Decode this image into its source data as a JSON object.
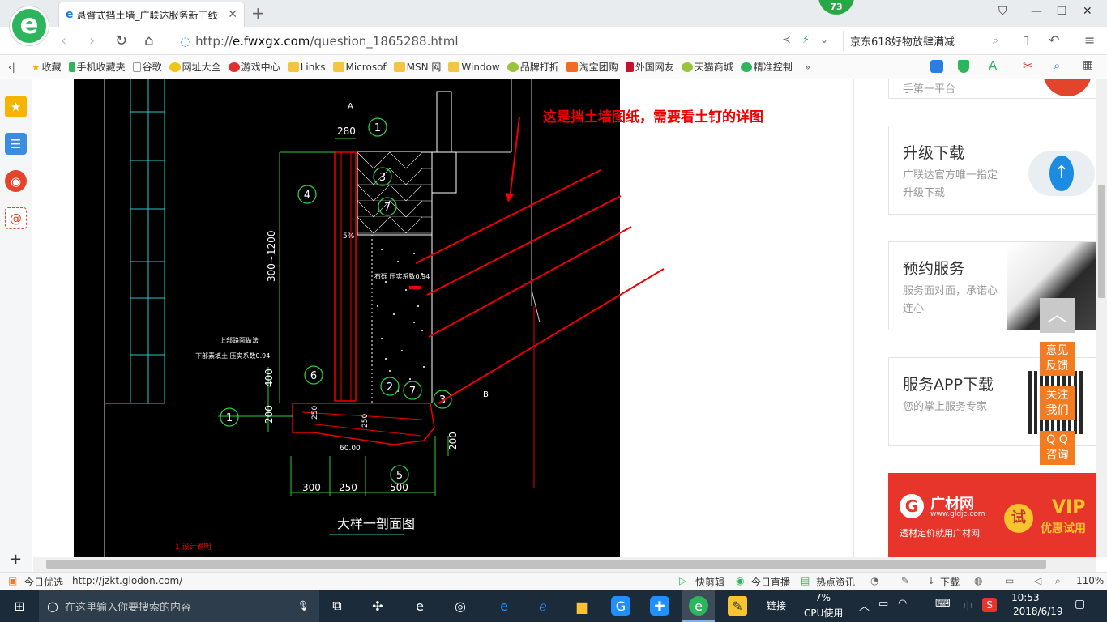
{
  "tab": {
    "title": "悬臂式挡土墙_广联达服务新干线",
    "badge": "73"
  },
  "address": {
    "url_prefix": "http://",
    "url_domain": "e.fwxgx.com",
    "url_path": "/question_1865288.html",
    "search_text": "京东618好物放肆满减"
  },
  "bookmarks": [
    "收藏",
    "手机收藏夹",
    "谷歌",
    "网址大全",
    "游戏中心",
    "Links",
    "Microsof",
    "MSN 网",
    "Window",
    "品牌打折",
    "淘宝团购",
    "外国网友",
    "天猫商城",
    "精准控制"
  ],
  "cad": {
    "annotation": "这是挡土墙图纸，需要看土钉的详图",
    "dims": {
      "top": "280",
      "height": "300~1200",
      "mid": "400",
      "base": "200",
      "b1": "300",
      "b2": "250",
      "b3": "500",
      "right": "200",
      "toe": "250",
      "heel": "250",
      "footer": "60.00"
    },
    "callouts": [
      "1",
      "3",
      "7",
      "4",
      "6",
      "2",
      "7",
      "3",
      "1",
      "5"
    ],
    "labels": {
      "slope": "5%",
      "section": "大样一剖面图",
      "note": "1 设计说明",
      "label_a": "A",
      "label_b": "B",
      "fill": "石砾 压实系数0.94",
      "layer1": "上部路面做法",
      "layer2": "下部素填土 压实系数0.94"
    }
  },
  "cards": [
    {
      "title": "升级下载",
      "desc": "广联达官方唯一指定升级下载"
    },
    {
      "title": "预约服务",
      "desc": "服务面对面，承诺心连心"
    },
    {
      "title": "服务APP下载",
      "desc": "您的掌上服务专家"
    }
  ],
  "top_card_partial": "手第一平台",
  "float_buttons": [
    "意见反馈",
    "关注我们",
    "Q Q咨询"
  ],
  "ad": {
    "brand": "广材网",
    "url": "www.gldjc.com",
    "slogan": "透材定价就用广材网",
    "try": "试",
    "vip": "VIP",
    "vip_sub": "优惠试用"
  },
  "statusbar": {
    "left": "今日优选",
    "link": "http://jzkt.glodon.com/",
    "items": [
      "快剪辑",
      "今日直播",
      "热点资讯",
      "下载"
    ],
    "zoom": "110%"
  },
  "taskbar": {
    "search": "在这里输入你要搜索的内容",
    "link": "链接",
    "cpu_pct": "7%",
    "cpu_label": "CPU使用",
    "ime": "中",
    "time": "10:53",
    "date": "2018/6/19"
  }
}
